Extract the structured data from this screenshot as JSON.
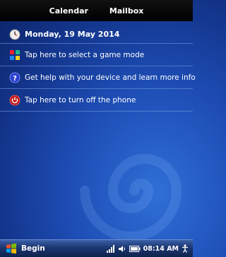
{
  "top_bar": {
    "left_label": "Calendar",
    "right_label": "Mailbox"
  },
  "today": {
    "date_text": "Monday, 19 May 2014",
    "icon": "clock-icon"
  },
  "items": [
    {
      "label": "Tap here to select a game mode",
      "icon": "game-mode-icon"
    },
    {
      "label": "Get help with your device and learn more info",
      "icon": "help-icon"
    },
    {
      "label": "Tap here to turn off the phone",
      "icon": "power-icon"
    }
  ],
  "taskbar": {
    "start_label": "Begin",
    "time": "08:14 AM",
    "tray_icons": [
      "signal-icon",
      "volume-icon",
      "battery-icon"
    ]
  },
  "colors": {
    "background": "#1d4db5",
    "separator": "#78a0e6",
    "top_bar": "#000000"
  }
}
